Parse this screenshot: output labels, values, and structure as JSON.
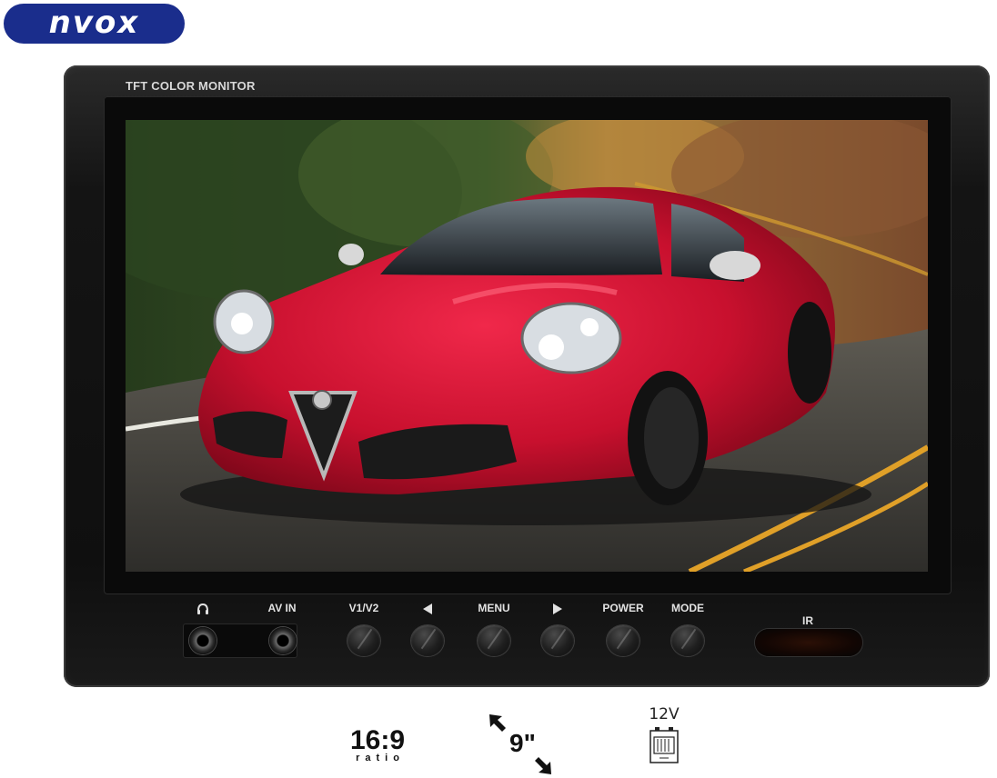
{
  "brand": {
    "logo_text": "nvox",
    "color": "#1a2d8c"
  },
  "monitor": {
    "title": "TFT COLOR MONITOR"
  },
  "controls": {
    "headphone_icon": "headphone-icon",
    "av_in": "AV IN",
    "v1v2": "V1/V2",
    "left_icon": "triangle-left-icon",
    "menu": "MENU",
    "right_icon": "triangle-right-icon",
    "power": "POWER",
    "mode": "MODE",
    "ir": "IR"
  },
  "features": {
    "ratio_value": "16:9",
    "ratio_label": "ratio",
    "size_value": "9\"",
    "voltage_value": "12V",
    "battery_icon": "battery-icon"
  }
}
